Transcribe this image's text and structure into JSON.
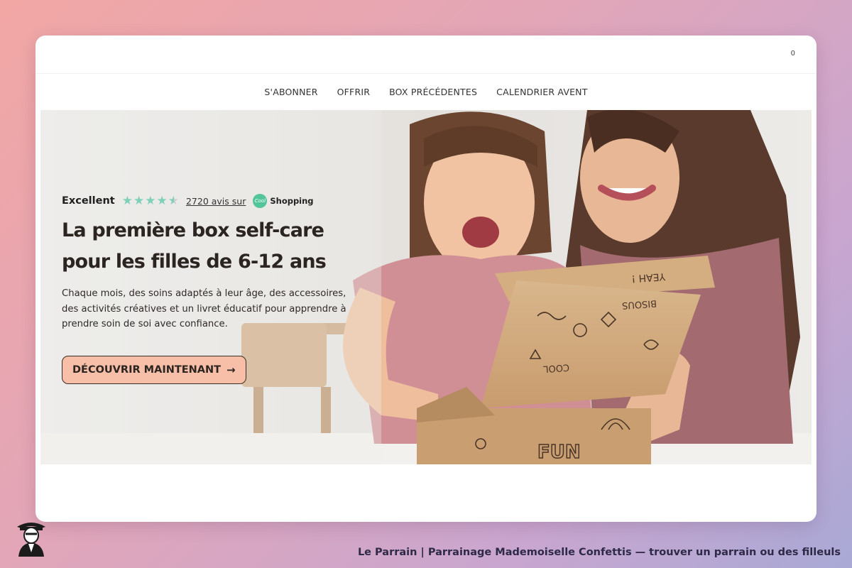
{
  "header": {
    "cart_count": "0"
  },
  "nav": {
    "items": [
      {
        "label": "S'ABONNER"
      },
      {
        "label": "OFFRIR"
      },
      {
        "label": "BOX PRÉCÉDENTES"
      },
      {
        "label": "CALENDRIER AVENT"
      }
    ]
  },
  "hero": {
    "rating": {
      "label": "Excellent",
      "stars": 4.5,
      "review_count": "2720 avis sur",
      "provider": "Shopping",
      "provider_logo_text": "Cool"
    },
    "title": "La première box self-care pour les filles de 6-12 ans",
    "description": "Chaque mois, des soins adaptés à leur âge, des accessoires, des activités créatives et un livret éducatif pour apprendre à prendre soin de soi avec confiance.",
    "cta_label": "DÉCOUVRIR MAINTENANT",
    "cta_icon": "arrow-right-icon",
    "image_icon": "mother-daughter-box-photo",
    "box_text": [
      "FUN",
      "YEAH !",
      "COOL",
      "BISOUS"
    ]
  },
  "footer": {
    "text": "Le Parrain | Parrainage Mademoiselle Confettis — trouver un parrain ou des filleuls",
    "logo_icon": "godfather-logo-icon"
  },
  "colors": {
    "accent_button": "#f7bfa7",
    "star_color": "#7fd0b9",
    "footer_text": "#2e2947"
  }
}
